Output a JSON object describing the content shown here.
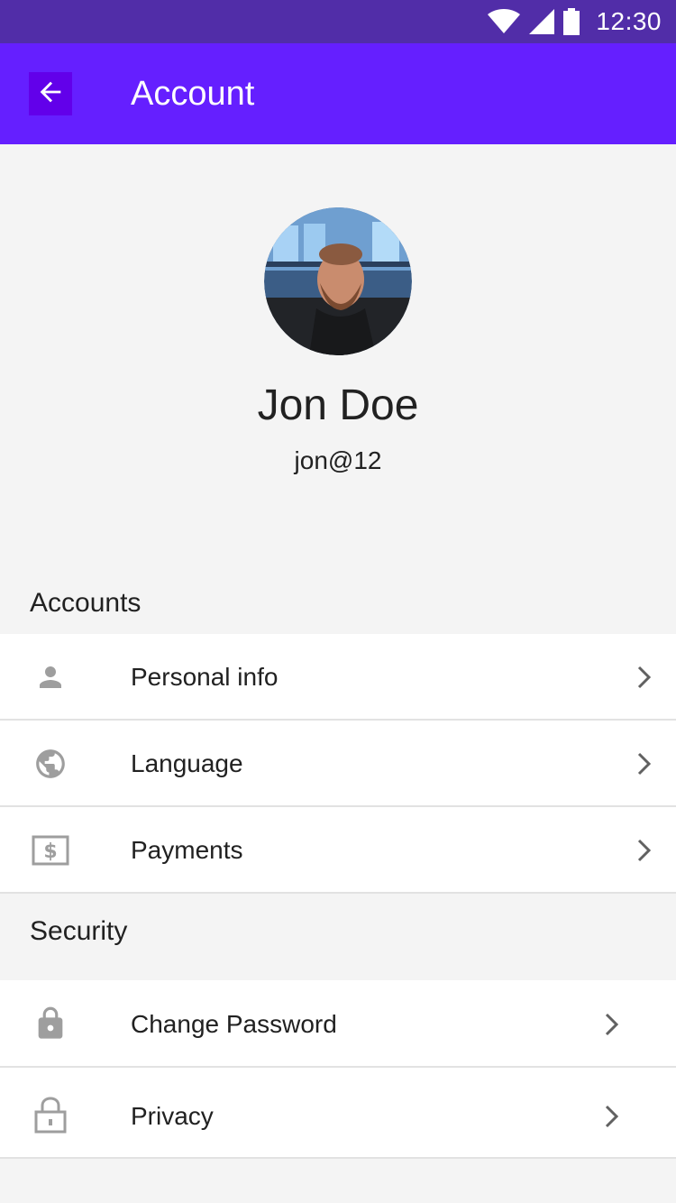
{
  "status_bar": {
    "time": "12:30"
  },
  "app_bar": {
    "title": "Account"
  },
  "profile": {
    "name": "Jon Doe",
    "handle": "jon@12"
  },
  "sections": [
    {
      "title": "Accounts",
      "items": [
        {
          "label": "Personal info",
          "icon": "person-icon"
        },
        {
          "label": "Language",
          "icon": "globe-icon"
        },
        {
          "label": "Payments",
          "icon": "payment-icon"
        }
      ]
    },
    {
      "title": "Security",
      "items": [
        {
          "label": "Change Password",
          "icon": "lock-icon"
        },
        {
          "label": "Privacy",
          "icon": "lock-outline-icon"
        }
      ]
    }
  ],
  "colors": {
    "status_bar": "#512da8",
    "app_bar": "#651fff",
    "back_button": "#6200ea",
    "icon_gray": "#9e9e9e",
    "chevron_gray": "#616161"
  }
}
